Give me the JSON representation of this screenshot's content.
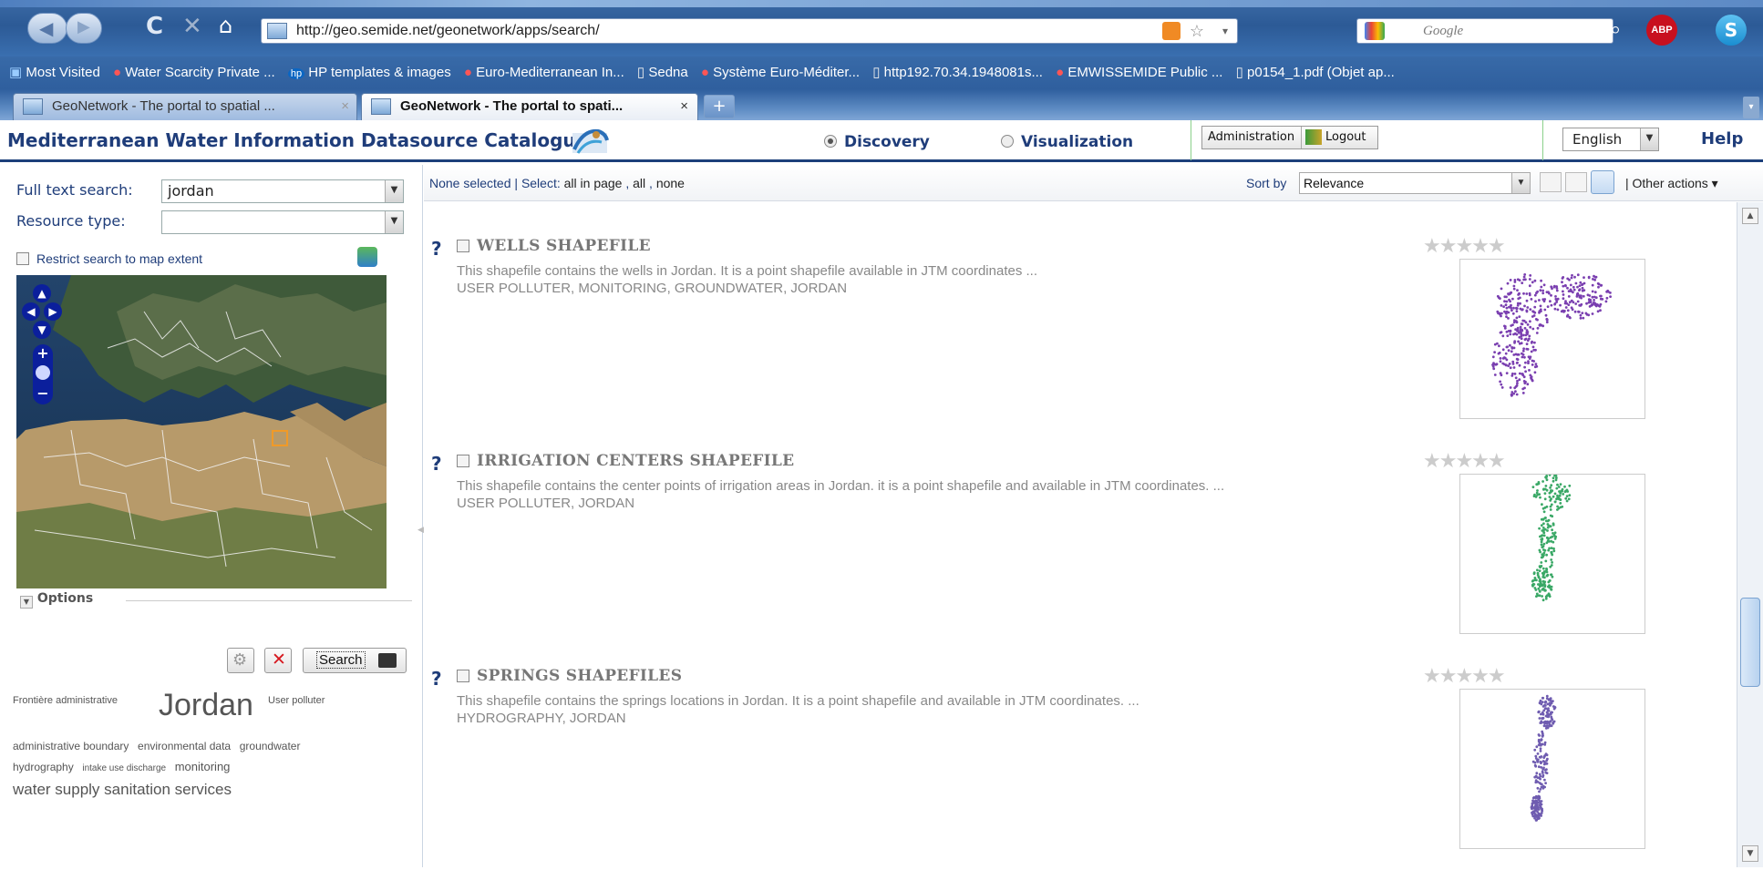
{
  "browser": {
    "url": "http://geo.semide.net/geonetwork/apps/search/",
    "search_engine_placeholder": "Google",
    "bookmarks": [
      "Most Visited",
      "Water Scarcity Private ...",
      "HP templates & images",
      "Euro-Mediterranean In...",
      "Sedna",
      "Système Euro-Méditer...",
      "http192.70.34.1948081s...",
      "EMWISSEMIDE Public ...",
      "p0154_1.pdf (Objet ap..."
    ],
    "tabs": [
      {
        "title": "GeoNetwork - The portal to spatial ...",
        "active": false
      },
      {
        "title": "GeoNetwork - The portal to spati...",
        "active": true
      }
    ],
    "new_tab_label": "+",
    "adblock_label": "ABP"
  },
  "header": {
    "site_title": "Mediterranean Water Information Datasource Catalogue",
    "modes": [
      {
        "label": "Discovery",
        "selected": true
      },
      {
        "label": "Visualization",
        "selected": false
      }
    ],
    "admin_label": "Administration",
    "logout_label": "Logout",
    "language": "English",
    "help_label": "Help"
  },
  "search": {
    "full_text_label": "Full text search:",
    "full_text_value": "jordan",
    "resource_type_label": "Resource type:",
    "resource_type_value": "",
    "restrict_label": "Restrict search to map extent",
    "options_label": "Options",
    "search_button_label": "Search"
  },
  "tag_cloud": [
    {
      "text": "Frontière administrative",
      "size": 11
    },
    {
      "text": "Jordan",
      "size": 34
    },
    {
      "text": "User polluter",
      "size": 11
    },
    {
      "text": "administrative boundary",
      "size": 12
    },
    {
      "text": "environmental data",
      "size": 12
    },
    {
      "text": "groundwater",
      "size": 12
    },
    {
      "text": "hydrography",
      "size": 12
    },
    {
      "text": "intake use discharge",
      "size": 10
    },
    {
      "text": "monitoring",
      "size": 13
    },
    {
      "text": "water supply sanitation services",
      "size": 17
    }
  ],
  "toolbar": {
    "none_selected": "None selected",
    "select_label": "Select:",
    "select_all_in_page": "all in page",
    "select_all": "all",
    "select_none": "none",
    "sort_by_label": "Sort by",
    "sort_by_value": "Relevance",
    "other_actions": "Other actions"
  },
  "results": [
    {
      "title": "WELLS SHAPEFILE",
      "description": "This shapefile contains the wells in Jordan. It is a point shapefile available in JTM coordinates ...",
      "keywords": "USER POLLUTER, MONITORING, GROUNDWATER, JORDAN",
      "thumb_color": "#7a3fb0"
    },
    {
      "title": "IRRIGATION CENTERS SHAPEFILE",
      "description": "This shapefile contains the center points of irrigation areas in Jordan. it is a point shapefile and available in JTM coordinates. ...",
      "keywords": "USER POLLUTER, JORDAN",
      "thumb_color": "#3aa866"
    },
    {
      "title": "SPRINGS SHAPEFILES",
      "description": "This shapefile contains the springs locations in Jordan. It is a point shapefile and available in JTM coordinates. ...",
      "keywords": "HYDROGRAPHY, JORDAN",
      "thumb_color": "#6f5cb0"
    }
  ]
}
